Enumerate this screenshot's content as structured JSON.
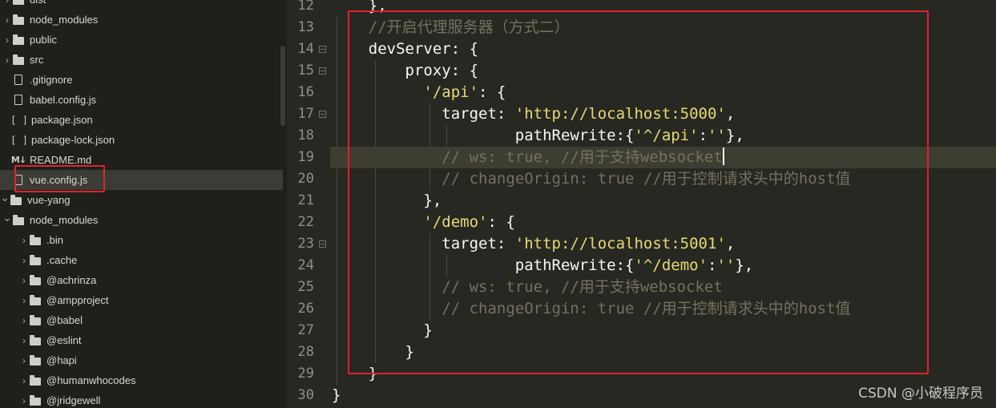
{
  "sidebar": {
    "rows": [
      {
        "label": "dist",
        "kind": "folder",
        "expanded": false,
        "indent": 0
      },
      {
        "label": "node_modules",
        "kind": "folder",
        "expanded": false,
        "indent": 0
      },
      {
        "label": "public",
        "kind": "folder",
        "expanded": false,
        "indent": 0
      },
      {
        "label": "src",
        "kind": "folder",
        "expanded": false,
        "indent": 0
      },
      {
        "label": ".gitignore",
        "kind": "file",
        "indent": 0
      },
      {
        "label": "babel.config.js",
        "kind": "file-js",
        "indent": 0
      },
      {
        "label": "package.json",
        "kind": "json",
        "indent": 0
      },
      {
        "label": "package-lock.json",
        "kind": "json",
        "indent": 0
      },
      {
        "label": "README.md",
        "kind": "md",
        "indent": 0
      },
      {
        "label": "vue.config.js",
        "kind": "file-js",
        "indent": 0,
        "selected": true
      },
      {
        "label": "vue-yang",
        "kind": "folder",
        "expanded": true,
        "indent": -1
      },
      {
        "label": "node_modules",
        "kind": "folder",
        "expanded": true,
        "indent": 0
      },
      {
        "label": ".bin",
        "kind": "folder",
        "expanded": false,
        "indent": 1
      },
      {
        "label": ".cache",
        "kind": "folder",
        "expanded": false,
        "indent": 1
      },
      {
        "label": "@achrinza",
        "kind": "folder",
        "expanded": false,
        "indent": 1
      },
      {
        "label": "@ampproject",
        "kind": "folder",
        "expanded": false,
        "indent": 1
      },
      {
        "label": "@babel",
        "kind": "folder",
        "expanded": false,
        "indent": 1
      },
      {
        "label": "@eslint",
        "kind": "folder",
        "expanded": false,
        "indent": 1
      },
      {
        "label": "@hapi",
        "kind": "folder",
        "expanded": false,
        "indent": 1
      },
      {
        "label": "@humanwhocodes",
        "kind": "folder",
        "expanded": false,
        "indent": 1
      },
      {
        "label": "@jridgewell",
        "kind": "folder",
        "expanded": false,
        "indent": 1
      }
    ]
  },
  "editor": {
    "active_line": 19,
    "lines": [
      {
        "n": 12,
        "fold": false,
        "tokens": [
          [
            "p",
            "    },"
          ]
        ]
      },
      {
        "n": 13,
        "fold": false,
        "tokens": [
          [
            "c",
            "    //开启代理服务器（方式二）"
          ]
        ]
      },
      {
        "n": 14,
        "fold": true,
        "tokens": [
          [
            "p",
            "    devServer: {"
          ]
        ]
      },
      {
        "n": 15,
        "fold": true,
        "tokens": [
          [
            "p",
            "        proxy: {"
          ]
        ]
      },
      {
        "n": 16,
        "fold": false,
        "tokens": [
          [
            "p",
            "          "
          ],
          [
            "s",
            "'/api'"
          ],
          [
            "p",
            ": {"
          ]
        ]
      },
      {
        "n": 17,
        "fold": true,
        "tokens": [
          [
            "p",
            "            target: "
          ],
          [
            "s",
            "'http://localhost:5000'"
          ],
          [
            "p",
            ","
          ]
        ]
      },
      {
        "n": 18,
        "fold": false,
        "tokens": [
          [
            "p",
            "                    pathRewrite:{"
          ],
          [
            "s",
            "'^/api'"
          ],
          [
            "p",
            ":"
          ],
          [
            "s",
            "''"
          ],
          [
            "p",
            "},"
          ]
        ]
      },
      {
        "n": 19,
        "fold": false,
        "tokens": [
          [
            "c",
            "            // ws: true, //用于支持websocket"
          ]
        ],
        "caret": true
      },
      {
        "n": 20,
        "fold": false,
        "tokens": [
          [
            "c",
            "            // changeOrigin: true //用于控制请求头中的host值"
          ]
        ]
      },
      {
        "n": 21,
        "fold": false,
        "tokens": [
          [
            "p",
            "          },"
          ]
        ]
      },
      {
        "n": 22,
        "fold": false,
        "tokens": [
          [
            "p",
            "          "
          ],
          [
            "s",
            "'/demo'"
          ],
          [
            "p",
            ": {"
          ]
        ]
      },
      {
        "n": 23,
        "fold": true,
        "tokens": [
          [
            "p",
            "            target: "
          ],
          [
            "s",
            "'http://localhost:5001'"
          ],
          [
            "p",
            ","
          ]
        ]
      },
      {
        "n": 24,
        "fold": false,
        "tokens": [
          [
            "p",
            "                    pathRewrite:{"
          ],
          [
            "s",
            "'^/demo'"
          ],
          [
            "p",
            ":"
          ],
          [
            "s",
            "''"
          ],
          [
            "p",
            "},"
          ]
        ]
      },
      {
        "n": 25,
        "fold": false,
        "tokens": [
          [
            "c",
            "            // ws: true, //用于支持websocket"
          ]
        ]
      },
      {
        "n": 26,
        "fold": false,
        "tokens": [
          [
            "c",
            "            // changeOrigin: true //用于控制请求头中的host值"
          ]
        ]
      },
      {
        "n": 27,
        "fold": false,
        "tokens": [
          [
            "p",
            "          }"
          ]
        ]
      },
      {
        "n": 28,
        "fold": false,
        "tokens": [
          [
            "p",
            "        }"
          ]
        ]
      },
      {
        "n": 29,
        "fold": false,
        "tokens": [
          [
            "p",
            "    }"
          ]
        ]
      },
      {
        "n": 30,
        "fold": false,
        "tokens": [
          [
            "p",
            "}"
          ]
        ]
      }
    ]
  },
  "watermark": "CSDN @小破程序员",
  "colors": {
    "editor_bg": "#272822",
    "sidebar_bg": "#1f201b",
    "string": "#e6db74",
    "comment": "#75715e",
    "plain": "#f8f8f2",
    "highlight_box": "#e0222a"
  }
}
